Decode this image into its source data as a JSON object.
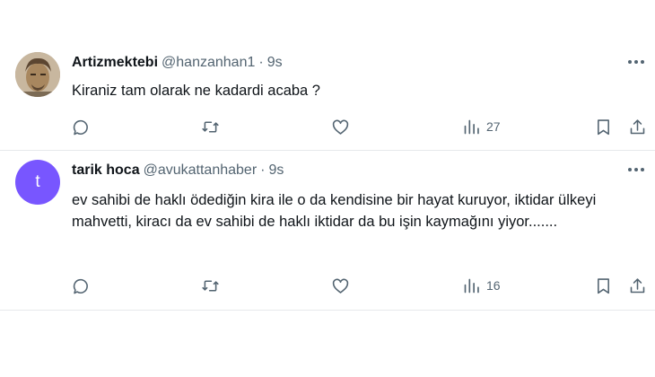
{
  "tweets": [
    {
      "display_name": "Artizmektebi",
      "handle": "@hanzanhan1",
      "separator": "·",
      "time": "9s",
      "text": "Kiraniz tam olarak ne kadardi acaba ?",
      "views": "27",
      "avatar": {
        "type": "photo"
      }
    },
    {
      "display_name": "tarik hoca",
      "handle": "@avukattanhaber",
      "separator": "·",
      "time": "9s",
      "text": "ev sahibi de haklı ödediğin kira ile o da kendisine bir hayat kuruyor, iktidar ülkeyi mahvetti, kiracı da ev sahibi de haklı iktidar da bu işin kaymağını yiyor.......",
      "views": "16",
      "avatar": {
        "type": "letter",
        "letter": "t",
        "color": "#7856ff"
      }
    }
  ],
  "colors": {
    "text": "#0f1419",
    "secondary": "#536471",
    "divider": "#e6e9eb"
  },
  "icons": [
    "reply-icon",
    "retweet-icon",
    "like-icon",
    "views-icon",
    "bookmark-icon",
    "share-icon",
    "more-icon"
  ]
}
